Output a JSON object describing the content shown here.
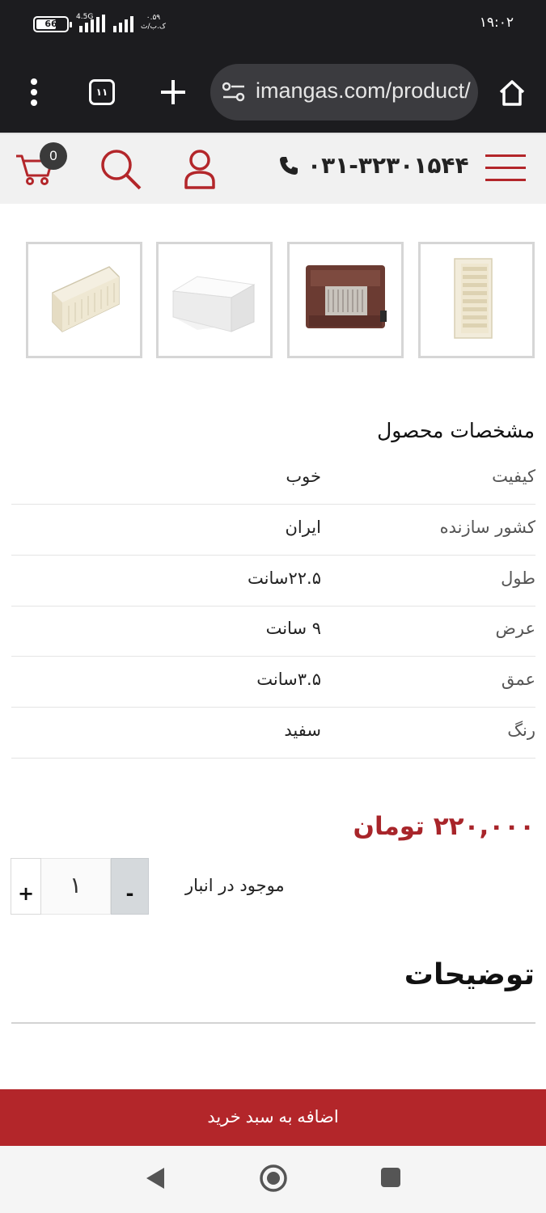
{
  "status_bar": {
    "battery": "66",
    "battery_level": 0.66,
    "network": "4.5G",
    "speed": "۰.۵۹",
    "speed_unit": "ک.ب/ث",
    "time": "۱۹:۰۲"
  },
  "browser": {
    "url": "imangas.com/product/",
    "tab_count": "۱۱",
    "icons": [
      "menu-dots-icon",
      "tabs-icon",
      "new-tab-icon",
      "site-info-icon",
      "home-icon"
    ]
  },
  "header": {
    "cart_count": "0",
    "phone": "۰۳۱-۳۲۳۰۱۵۴۴",
    "icons": [
      "cart-icon",
      "search-icon",
      "user-icon",
      "phone-icon",
      "hamburger-icon"
    ],
    "accent": "#b3262a"
  },
  "specs": {
    "title": "مشخصات محصول",
    "rows": [
      {
        "key": "کیفیت",
        "value": "خوب"
      },
      {
        "key": "کشور سازنده",
        "value": "ایران"
      },
      {
        "key": "طول",
        "value": "۲۲.۵سانت"
      },
      {
        "key": "عرض",
        "value": "۹ سانت"
      },
      {
        "key": "عمق",
        "value": "۳.۵سانت"
      },
      {
        "key": "رنگ",
        "value": "سفید"
      }
    ]
  },
  "price": "۲۲۰,۰۰۰ تومان",
  "price_color": "#a8252a",
  "stock": "موجود در انبار",
  "quantity": {
    "value": "۱",
    "plus": "+",
    "minus": "-"
  },
  "description_title": "توضیحات",
  "add_to_cart": "اضافه به سبد خرید"
}
